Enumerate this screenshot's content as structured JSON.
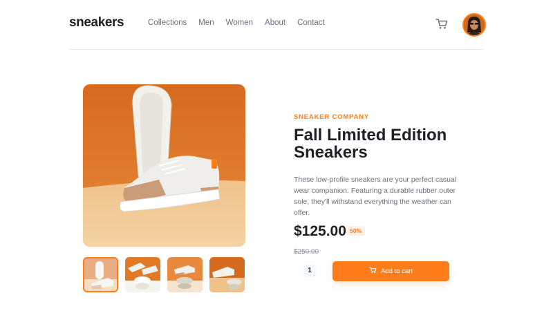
{
  "header": {
    "logo": "sneakers",
    "nav": [
      "Collections",
      "Men",
      "Women",
      "About",
      "Contact"
    ],
    "icons": {
      "cart": "cart-icon",
      "avatar": "avatar"
    }
  },
  "product": {
    "company": "SNEAKER COMPANY",
    "title": "Fall Limited Edition Sneakers",
    "description": "These low-profile sneakers are your perfect casual wear companion. Featuring a durable rubber outer sole, they'll withstand everything the weather can offer.",
    "price": "$125.00",
    "discount": "50%",
    "old_price": "$250.00",
    "quantity": "1",
    "add_to_cart": "Add to cart"
  },
  "colors": {
    "accent": "#ff7e1b",
    "text_dark": "#1d2026",
    "text_muted": "#68707d"
  }
}
